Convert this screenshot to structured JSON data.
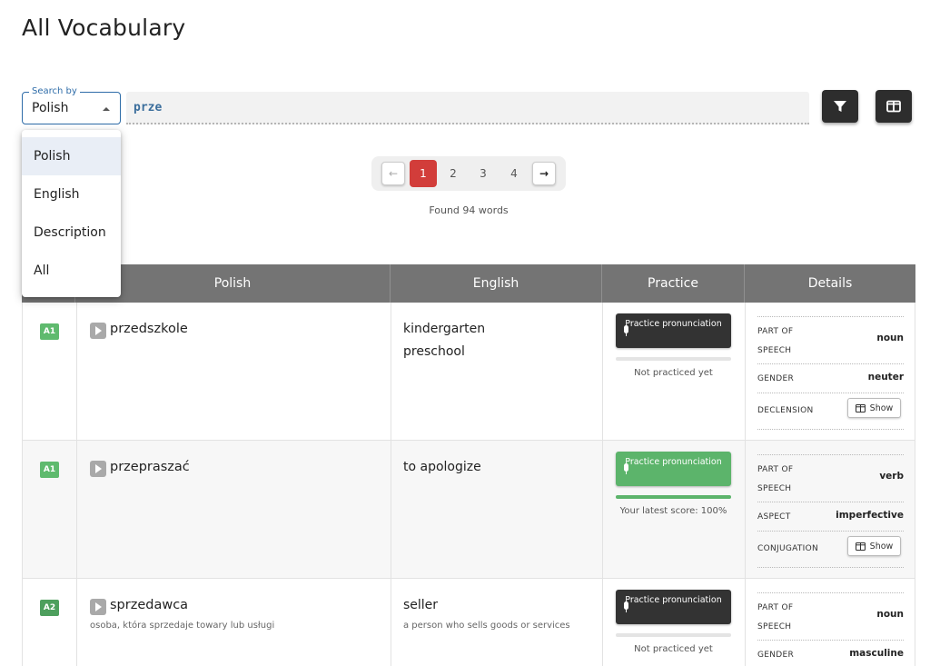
{
  "page": {
    "title": "All Vocabulary"
  },
  "search": {
    "by_legend": "Search by",
    "by_value": "Polish",
    "query": "prze",
    "options": [
      "Polish",
      "English",
      "Description",
      "All"
    ],
    "selected_option": "Polish"
  },
  "toolbar": {
    "filter_icon": "filter-icon",
    "columns_icon": "columns-icon"
  },
  "pagination": {
    "prev": "←",
    "pages": [
      "1",
      "2",
      "3",
      "4"
    ],
    "active": "1",
    "next": "→",
    "found": "Found 94 words"
  },
  "table": {
    "headers": [
      "Polish",
      "English",
      "Practice",
      "Details"
    ],
    "rows": [
      {
        "level": "A1",
        "word": "przedszkole",
        "description": "",
        "english": [
          "kindergarten",
          "preschool"
        ],
        "english_description": "",
        "practice_label": "Practice pronunciation",
        "practice_status": "Not practiced yet",
        "practice_score": 0,
        "details": [
          {
            "label": "PART OF SPEECH",
            "value": "noun"
          },
          {
            "label": "GENDER",
            "value": "neuter"
          },
          {
            "label": "DECLENSION",
            "button": "Show"
          }
        ]
      },
      {
        "level": "A1",
        "word": "przepraszać",
        "description": "",
        "english": [
          "to apologize"
        ],
        "english_description": "",
        "practice_label": "Practice pronunciation",
        "practice_status": "Your latest score: 100%",
        "practice_score": 1.0,
        "details": [
          {
            "label": "PART OF SPEECH",
            "value": "verb"
          },
          {
            "label": "ASPECT",
            "value": "imperfective"
          },
          {
            "label": "CONJUGATION",
            "button": "Show"
          }
        ]
      },
      {
        "level": "A2",
        "word": "sprzedawca",
        "description": "osoba, która sprzedaje towary lub usługi",
        "english": [
          "seller"
        ],
        "english_description": "a person who sells goods or services",
        "practice_label": "Practice pronunciation",
        "practice_status": "Not practiced yet",
        "practice_score": 0,
        "details": [
          {
            "label": "PART OF SPEECH",
            "value": "noun"
          },
          {
            "label": "GENDER",
            "value": "masculine"
          }
        ]
      }
    ]
  },
  "colors": {
    "accent": "#d23d3a",
    "header_bg": "#747474",
    "level_green": "#5fba6e",
    "practice_dark": "#333333",
    "practice_green": "#5cb46b"
  }
}
